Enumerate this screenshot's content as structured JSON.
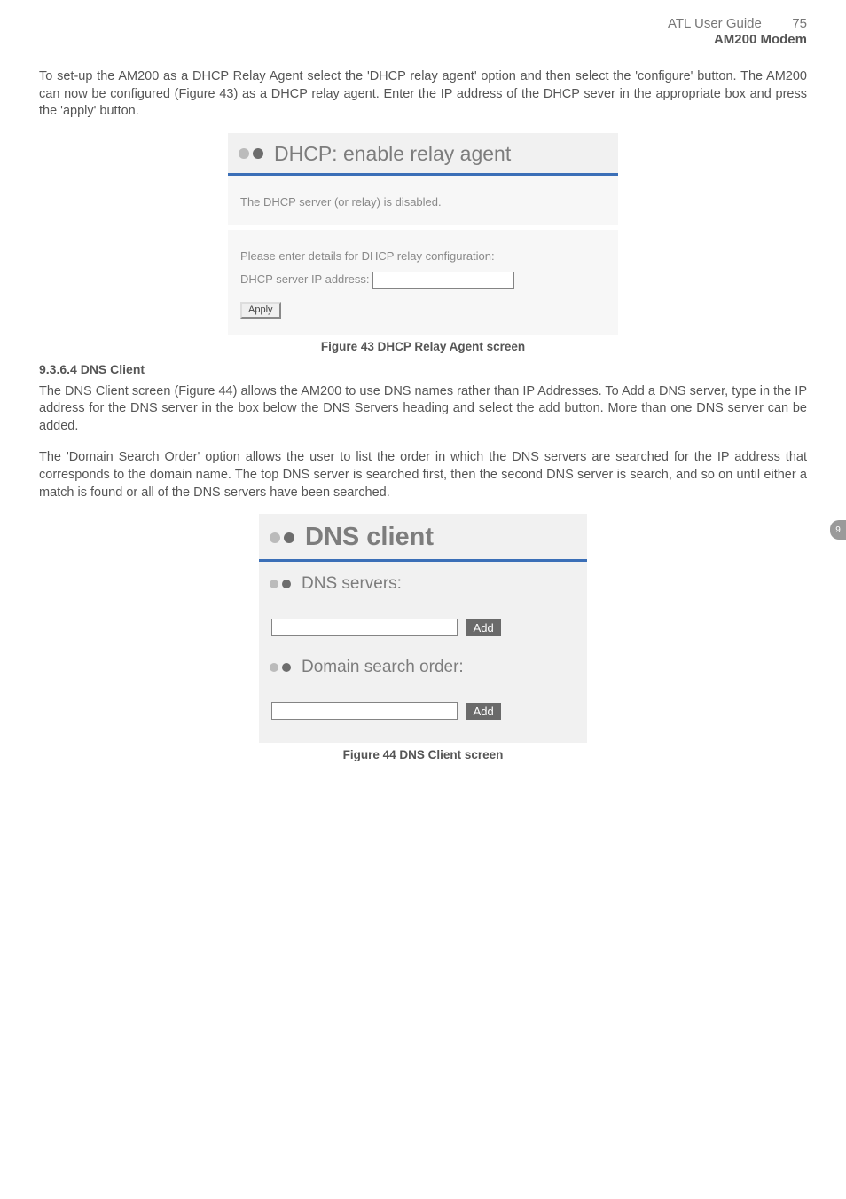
{
  "header": {
    "title": "ATL User Guide",
    "page": "75",
    "subtitle": "AM200 Modem"
  },
  "side_tab": "9",
  "para1": "To set-up the AM200 as a DHCP Relay Agent select the 'DHCP relay agent' option and then select the 'configure' button. The AM200 can now be configured (Figure 43) as a DHCP relay agent. Enter the IP address of the DHCP sever in the appropriate box and press the 'apply' button.",
  "screenshot1": {
    "title": "DHCP: enable relay agent",
    "msg1": "The DHCP server (or relay) is disabled.",
    "msg2": "Please enter details for DHCP relay configuration:",
    "ip_label": "DHCP server IP address:",
    "ip_value": "",
    "apply": "Apply"
  },
  "fig43": "Figure 43 DHCP Relay Agent screen",
  "heading2": "9.3.6.4 DNS Client",
  "para2": "The DNS Client screen (Figure 44) allows the AM200 to use DNS names rather than IP Addresses. To Add a DNS server, type in the IP address for the DNS server in the box below the DNS Servers heading and select the add button. More than one DNS server can be added.",
  "para3": "The 'Domain Search Order' option allows the user to list the order in which the DNS servers are searched for the IP address that corresponds to the domain name. The top DNS server is searched first, then the second DNS server is search, and so on until either a match is found or all of the DNS servers have been searched.",
  "screenshot2": {
    "title": "DNS client",
    "sub1": "DNS servers:",
    "input1": "",
    "add1": "Add",
    "sub2": "Domain search order:",
    "input2": "",
    "add2": "Add"
  },
  "fig44": "Figure 44 DNS Client screen"
}
